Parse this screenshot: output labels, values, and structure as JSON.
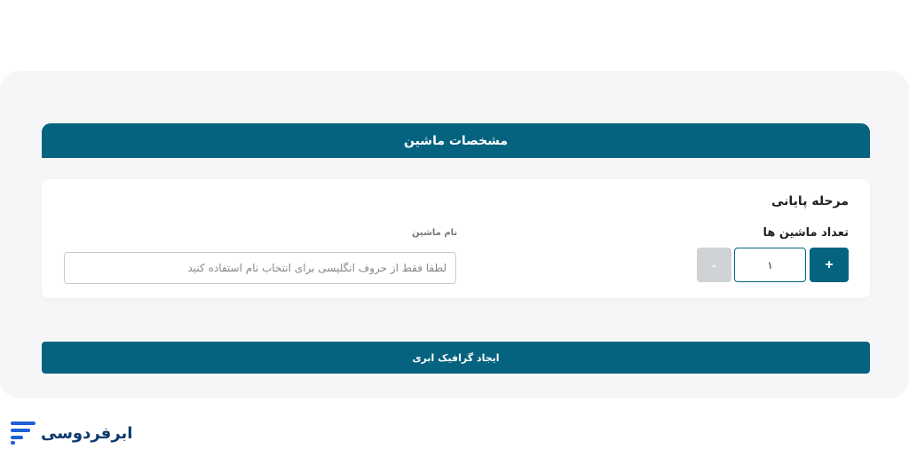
{
  "header": {
    "title": "مشخصات ماشین"
  },
  "card": {
    "stage_title": "مرحله پایانی",
    "count_label": "تعداد ماشین ها",
    "name_label": "نام ماشین",
    "plus_label": "+",
    "minus_label": "-",
    "count_value": "۱",
    "name_placeholder": "لطفا فقط از حروف انگلیسی برای انتخاب نام استفاده کنید"
  },
  "actions": {
    "create_label": "ایجاد گرافیک ابری"
  },
  "brand": {
    "name": "ابرفردوسی",
    "icon": "brand-logo-icon"
  },
  "colors": {
    "accent": "#05637f",
    "disabled": "#cfd3d6",
    "brand_blue": "#0b3b6e"
  }
}
